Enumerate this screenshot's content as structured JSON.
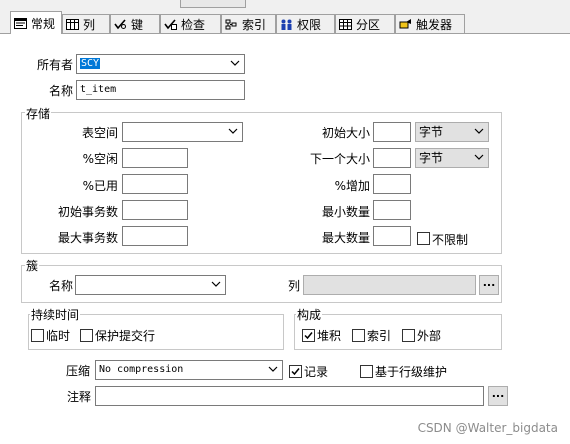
{
  "tabs": [
    {
      "label": "常规",
      "icon": "general-icon",
      "active": true
    },
    {
      "label": "列",
      "icon": "columns-icon"
    },
    {
      "label": "键",
      "icon": "key-icon"
    },
    {
      "label": "检查",
      "icon": "check-icon"
    },
    {
      "label": "索引",
      "icon": "index-icon"
    },
    {
      "label": "权限",
      "icon": "users-icon"
    },
    {
      "label": "分区",
      "icon": "partition-icon"
    },
    {
      "label": "触发器",
      "icon": "trigger-icon"
    }
  ],
  "general": {
    "owner_label": "所有者",
    "owner_value": "SCY",
    "name_label": "名称",
    "name_value": "t_item"
  },
  "storage": {
    "title": "存储",
    "tablespace_label": "表空间",
    "tablespace_value": "",
    "pct_free_label": "%空闲",
    "pct_free_value": "",
    "pct_used_label": "%已用",
    "pct_used_value": "",
    "init_trans_label": "初始事务数",
    "init_trans_value": "",
    "max_trans_label": "最大事务数",
    "max_trans_value": "",
    "initial_label": "初始大小",
    "initial_value": "",
    "initial_unit": "字节",
    "next_label": "下一个大小",
    "next_value": "",
    "next_unit": "字节",
    "pct_increase_label": "%增加",
    "pct_increase_value": "",
    "min_extents_label": "最小数量",
    "min_extents_value": "",
    "max_extents_label": "最大数量",
    "max_extents_value": "",
    "unlimited_label": "不限制",
    "unlimited_checked": false
  },
  "cluster": {
    "title": "簇",
    "name_label": "名称",
    "name_value": "",
    "columns_label": "列",
    "columns_value": "",
    "ellipsis": "..."
  },
  "duration": {
    "title": "持续时间",
    "temporary_label": "临时",
    "temporary_checked": false,
    "preserve_label": "保护提交行",
    "preserve_checked": false
  },
  "organization": {
    "title": "构成",
    "heap_label": "堆积",
    "heap_checked": true,
    "index_label": "索引",
    "index_checked": false,
    "external_label": "外部",
    "external_checked": false
  },
  "compression": {
    "label": "压缩",
    "value": "No compression"
  },
  "logging": {
    "label": "记录",
    "checked": true
  },
  "row_movement": {
    "label": "基于行级维护",
    "checked": false
  },
  "comment": {
    "label": "注释",
    "value": "",
    "ellipsis": "..."
  },
  "watermark": "CSDN @Walter_bigdata",
  "colors": {
    "accent": "#0078d7",
    "border": "#7a7a7a",
    "group_border": "#c8c8c8",
    "panel": "#ffffff",
    "chrome": "#f0f0f0"
  }
}
